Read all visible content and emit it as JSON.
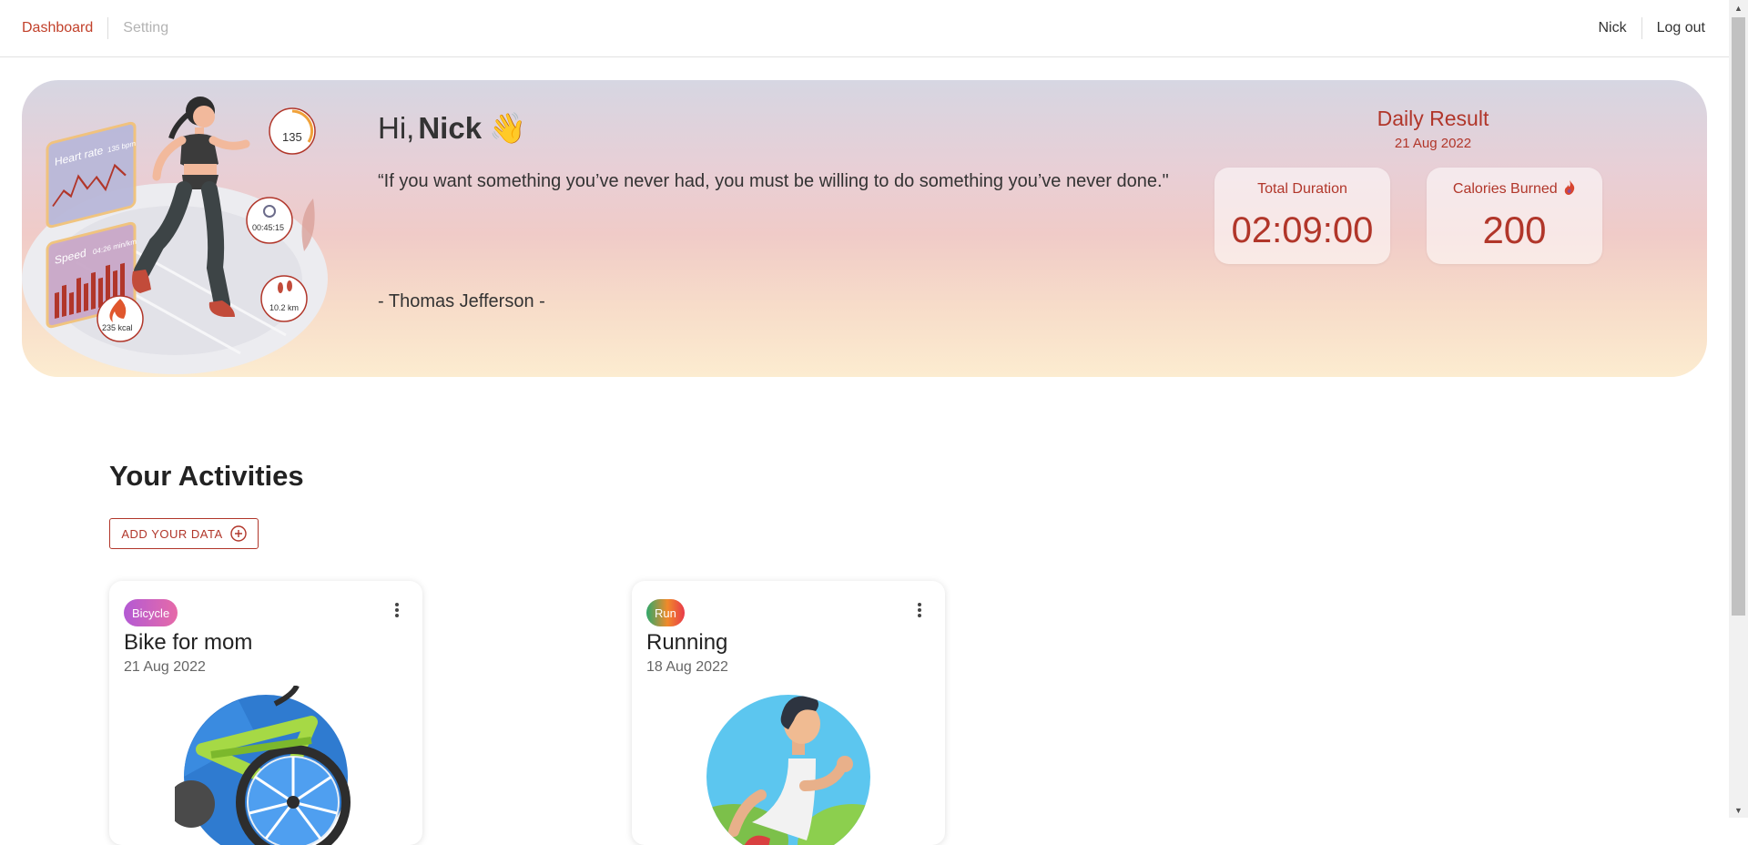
{
  "nav": {
    "dashboard_label": "Dashboard",
    "setting_label": "Setting",
    "user_name": "Nick",
    "logout_label": "Log out"
  },
  "hero": {
    "greeting_prefix": "Hi,",
    "greeting_name": "Nick",
    "wave_emoji": "👋",
    "quote": "“If you want something you’ve never had, you must be willing to do something you’ve never done.\"",
    "author": "- Thomas Jefferson -",
    "illustration": {
      "icon": "runner-illustration",
      "heart_rate_label": "Heart rate",
      "heart_rate_value": "135 bpm",
      "heart_rate_ring": "135",
      "speed_label": "Speed",
      "speed_value": "04:26 min/km",
      "time": "00:45:15",
      "distance": "10.2 km",
      "calories": "235 kcal"
    }
  },
  "daily_result": {
    "title": "Daily Result",
    "date": "21 Aug 2022",
    "duration_label": "Total Duration",
    "duration_value": "02:09:00",
    "calories_label": "Calories Burned",
    "calories_icon": "fire-icon",
    "calories_value": "200"
  },
  "activities": {
    "title": "Your Activities",
    "add_button_label": "ADD YOUR DATA",
    "add_button_icon": "plus-circle-icon",
    "items": [
      {
        "badge": "Bicycle",
        "title": "Bike for mom",
        "date": "21 Aug 2022",
        "image": "bicycle-illustration"
      },
      {
        "badge": "Run",
        "title": "Running",
        "date": "18 Aug 2022",
        "image": "runner-avatar-illustration"
      }
    ]
  },
  "colors": {
    "accent": "#b1362a",
    "nav_active": "#c2412b",
    "nav_inactive": "#b3b3b3"
  }
}
